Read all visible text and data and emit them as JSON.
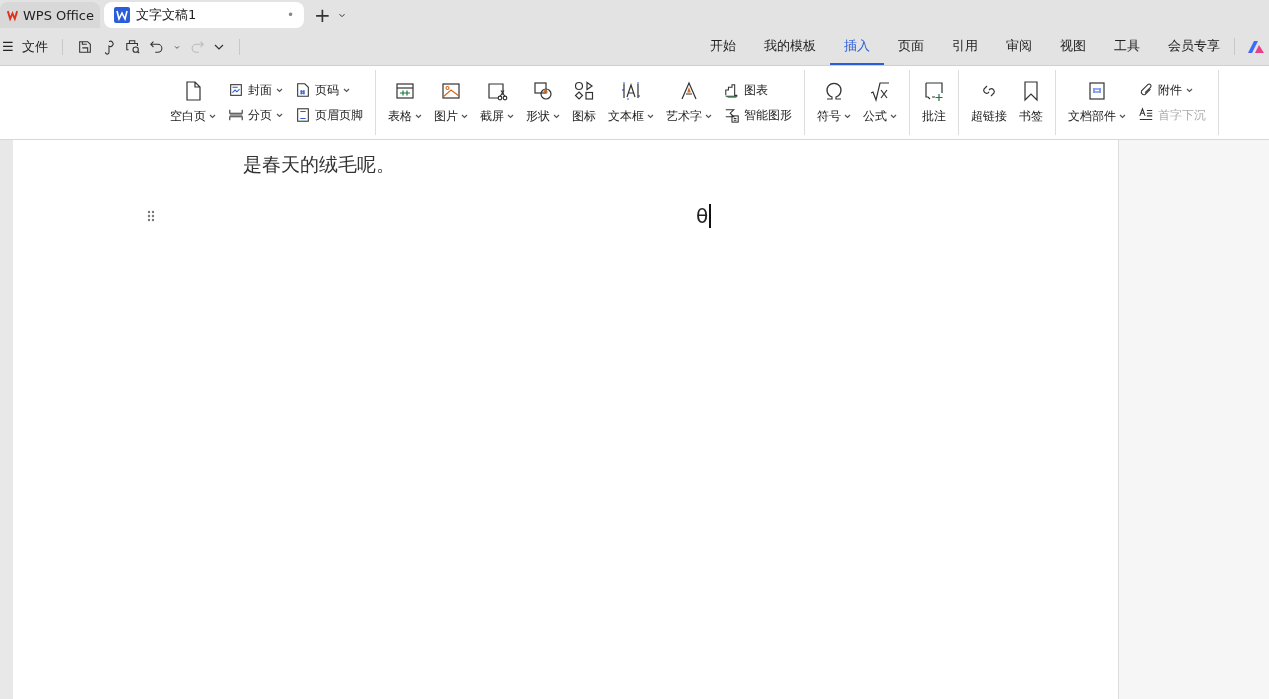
{
  "app_tabs": [
    {
      "label": "WPS Office",
      "kind": "home",
      "selected": false
    },
    {
      "label": "文字文稿1",
      "kind": "doc",
      "selected": true,
      "close": "•"
    }
  ],
  "new_tab": "+",
  "quick_bar": {
    "menu_icon": "☰",
    "file_label": "文件"
  },
  "menu_tabs": [
    {
      "label": "开始",
      "selected": false
    },
    {
      "label": "我的模板",
      "selected": false
    },
    {
      "label": "插入",
      "selected": true
    },
    {
      "label": "页面",
      "selected": false
    },
    {
      "label": "引用",
      "selected": false
    },
    {
      "label": "审阅",
      "selected": false
    },
    {
      "label": "视图",
      "selected": false
    },
    {
      "label": "工具",
      "selected": false
    },
    {
      "label": "会员专享",
      "selected": false
    }
  ],
  "ribbon_groups": [
    {
      "items": [
        {
          "kind": "big",
          "label": "空白页",
          "dropdown": true
        },
        {
          "kind": "stack",
          "items": [
            {
              "label": "封面",
              "dropdown": true,
              "disabled": false
            },
            {
              "label": "分页",
              "dropdown": true,
              "disabled": false
            }
          ]
        },
        {
          "kind": "stack",
          "items": [
            {
              "label": "页码",
              "dropdown": true,
              "disabled": false
            },
            {
              "label": "页眉页脚",
              "dropdown": false,
              "disabled": false
            }
          ]
        }
      ]
    },
    {
      "items": [
        {
          "kind": "big",
          "label": "表格",
          "dropdown": true
        },
        {
          "kind": "big",
          "label": "图片",
          "dropdown": true
        },
        {
          "kind": "big",
          "label": "截屏",
          "dropdown": true
        },
        {
          "kind": "big",
          "label": "形状",
          "dropdown": true
        },
        {
          "kind": "big",
          "label": "图标",
          "dropdown": false
        },
        {
          "kind": "big",
          "label": "文本框",
          "dropdown": true
        },
        {
          "kind": "big",
          "label": "艺术字",
          "dropdown": true
        },
        {
          "kind": "stack",
          "items": [
            {
              "label": "图表",
              "dropdown": false,
              "disabled": false
            },
            {
              "label": "智能图形",
              "dropdown": false,
              "disabled": false
            }
          ]
        }
      ]
    },
    {
      "items": [
        {
          "kind": "big",
          "label": "符号",
          "dropdown": true
        },
        {
          "kind": "big",
          "label": "公式",
          "dropdown": true
        }
      ]
    },
    {
      "items": [
        {
          "kind": "big",
          "label": "批注",
          "dropdown": false
        }
      ]
    },
    {
      "items": [
        {
          "kind": "big",
          "label": "超链接",
          "dropdown": false
        },
        {
          "kind": "big",
          "label": "书签",
          "dropdown": false
        }
      ]
    },
    {
      "items": [
        {
          "kind": "big",
          "label": "文档部件",
          "dropdown": true
        },
        {
          "kind": "stack",
          "items": [
            {
              "label": "附件",
              "dropdown": true,
              "disabled": false
            },
            {
              "label": "首字下沉",
              "dropdown": false,
              "disabled": true
            }
          ]
        }
      ]
    }
  ],
  "document": {
    "paragraphs": [
      "是春天的绒毛呢。",
      "θ"
    ]
  }
}
